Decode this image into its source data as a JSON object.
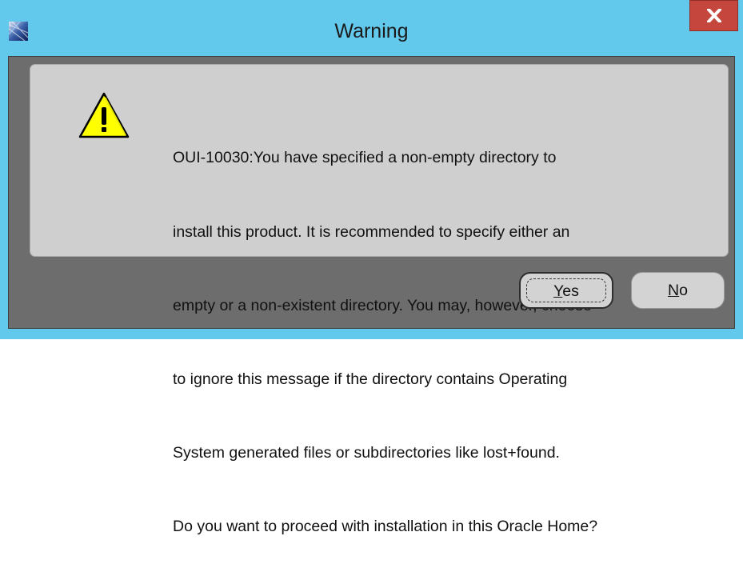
{
  "window": {
    "title": "Warning",
    "icon": "oracle-installer-icon",
    "close_icon": "close-icon",
    "close_color": "#c5463c",
    "frame_color": "#62c8ec"
  },
  "dialog": {
    "icon": "warning-icon",
    "message_lines": [
      "OUI-10030:You have specified a non-empty directory to",
      "install this product. It is recommended to specify either an",
      "empty or a non-existent directory. You may, however, choose",
      "to ignore this message if the directory contains Operating",
      "System generated files or subdirectories like lost+found.",
      "Do you want to proceed with installation in this Oracle Home?"
    ]
  },
  "buttons": {
    "yes": {
      "mnemonic": "Y",
      "rest": "es"
    },
    "no": {
      "mnemonic": "N",
      "rest": "o"
    }
  }
}
